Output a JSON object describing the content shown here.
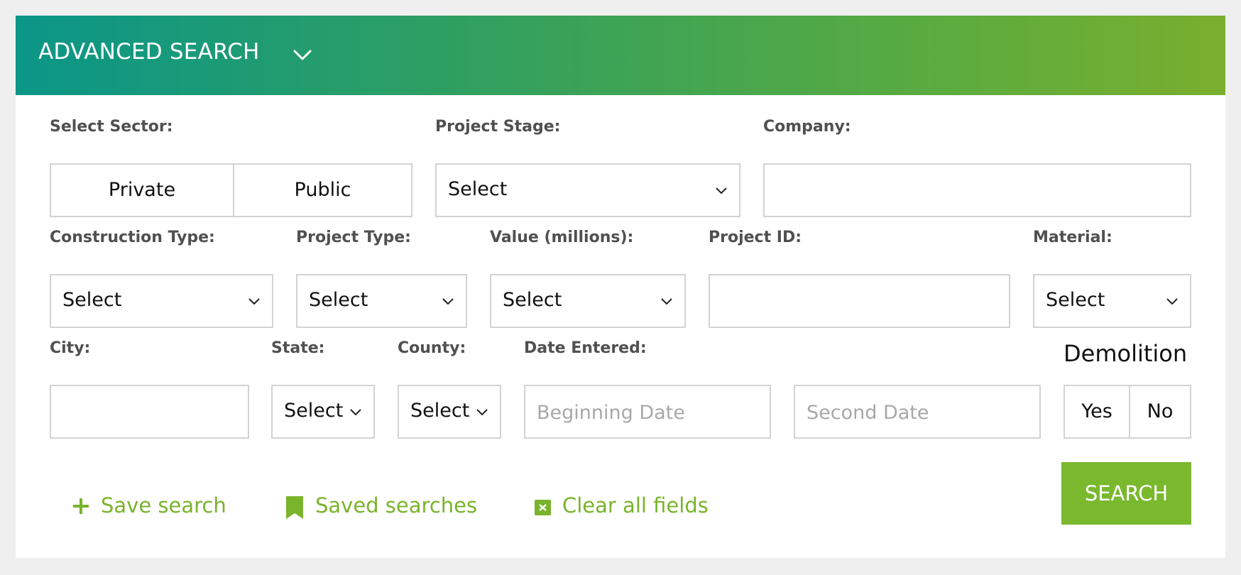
{
  "header": {
    "title": "ADVANCED SEARCH",
    "toggle_icon": "chevron-down-icon"
  },
  "colors": {
    "header_gradient_start": "#0b9688",
    "header_gradient_end": "#7aaf2e",
    "accent_green": "#7ab82d",
    "label_gray": "#505050",
    "border": "#d3d3d3",
    "background": "#efefef"
  },
  "fields": {
    "sector": {
      "label": "Select Sector:",
      "options": [
        "Private",
        "Public"
      ]
    },
    "project_stage": {
      "label": "Project Stage:",
      "value": "Select"
    },
    "company": {
      "label": "Company:",
      "value": ""
    },
    "construction_type": {
      "label": "Construction Type:",
      "value": "Select"
    },
    "project_type": {
      "label": "Project Type:",
      "value": "Select"
    },
    "value_millions": {
      "label": "Value (millions):",
      "value": "Select"
    },
    "project_id": {
      "label": "Project ID:",
      "value": ""
    },
    "material": {
      "label": "Material:",
      "value": "Select"
    },
    "city": {
      "label": "City:",
      "value": ""
    },
    "state": {
      "label": "State:",
      "value": "Select"
    },
    "county": {
      "label": "County:",
      "value": "Select"
    },
    "date_entered": {
      "label": "Date Entered:",
      "beginning_placeholder": "Beginning Date",
      "second_placeholder": "Second Date"
    },
    "demolition": {
      "label": "Demolition",
      "options": [
        "Yes",
        "No"
      ]
    }
  },
  "actions": {
    "save_search": {
      "label": "Save search",
      "icon": "plus-icon"
    },
    "saved_searches": {
      "label": "Saved searches",
      "icon": "bookmark-icon"
    },
    "clear_all": {
      "label": "Clear all fields",
      "icon": "clear-icon"
    },
    "search_button": "SEARCH"
  }
}
